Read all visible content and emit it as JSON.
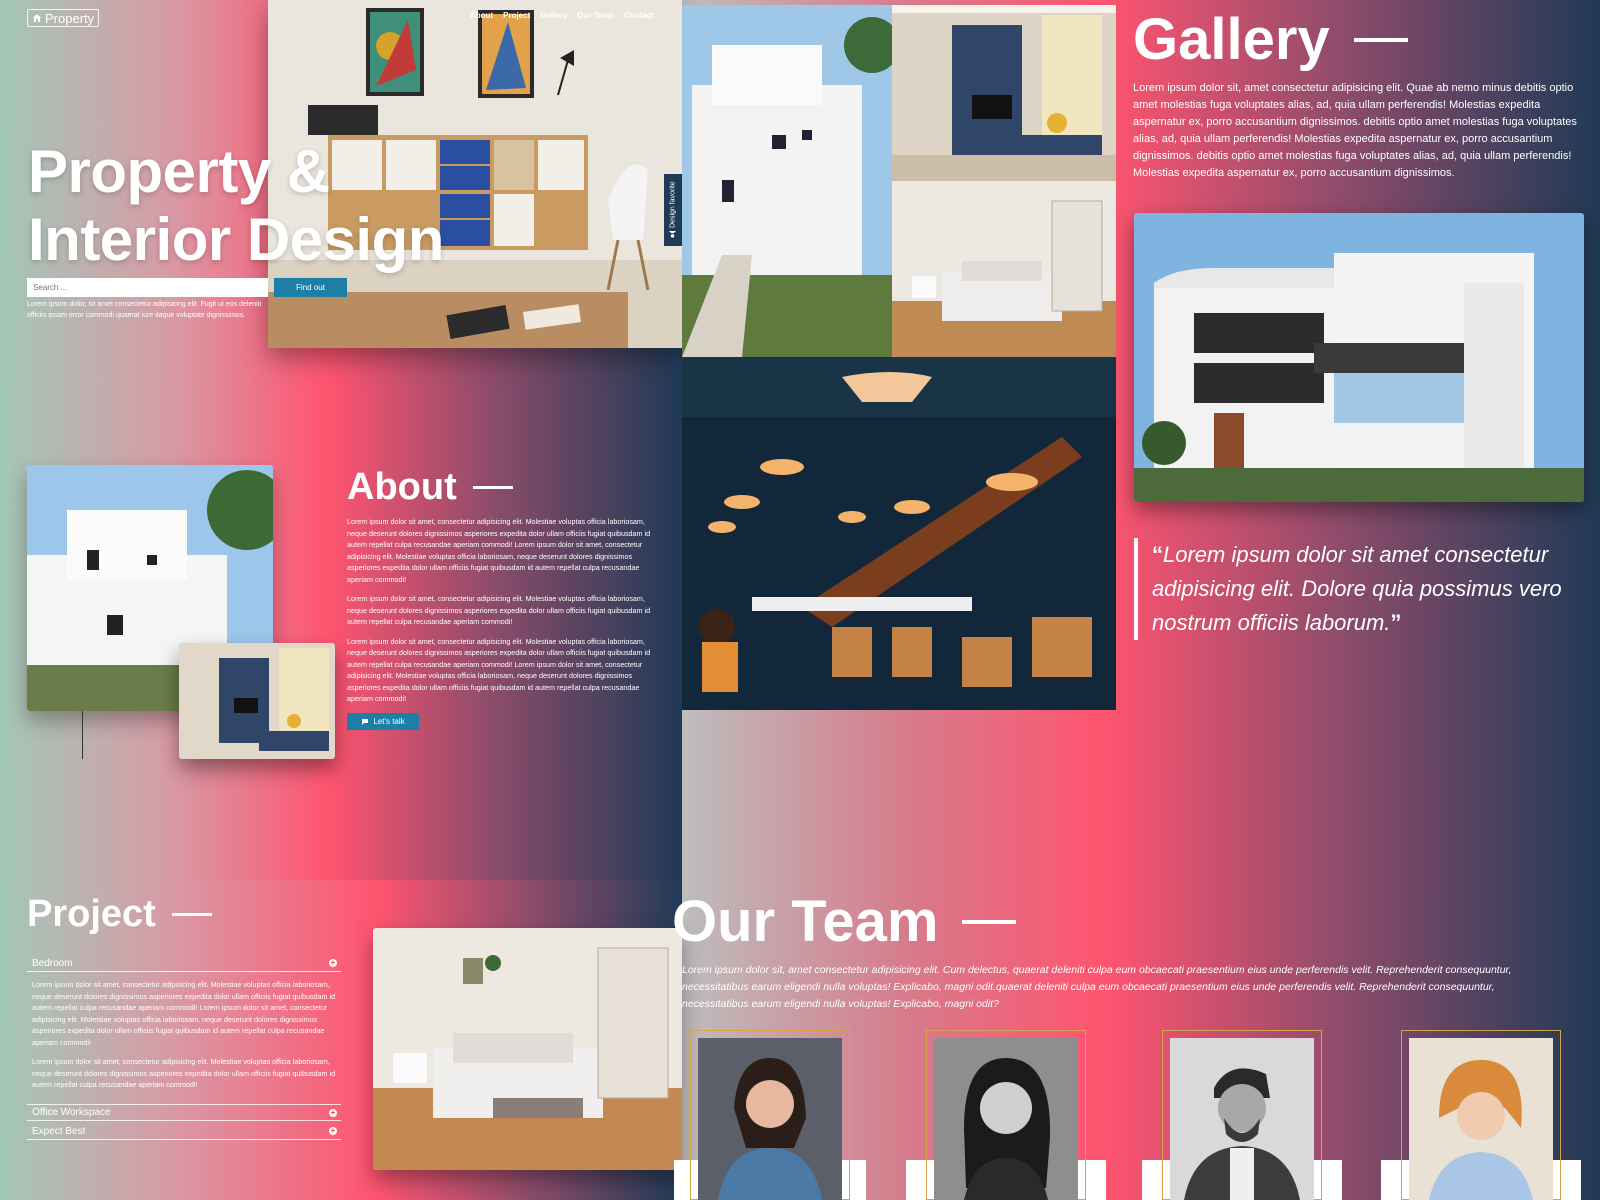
{
  "colors": {
    "accent": "#1d7fa6",
    "pink": "#ff5470",
    "navy": "#1f3a56",
    "frame_gold": "#d7a24a"
  },
  "brand": {
    "name": "Property",
    "icon": "home-icon"
  },
  "nav": [
    "About",
    "Project",
    "Gallery",
    "Our Team",
    "Contact"
  ],
  "hero": {
    "title_line1": "Property &",
    "title_line2": "Interior Design",
    "search_placeholder": "Search ...",
    "find_out": "Find out",
    "subtext": "Lorem ipsum dolor, sit amet consectetur adipisicing elit. Fugit ut eos deleniti officiis ipsam error commodi quaerat iure itaque voluptate dignissimos.",
    "favorite_tab": "Design favorite"
  },
  "about": {
    "title": "About",
    "paragraphs": [
      "Lorem ipsum dolor sit amet, consectetur adipisicing elit. Molestiae voluptas officia laboriosam, neque deserunt dolores dignissimos asperiores expedita dolor ullam officiis fugiat quibusdam id autem repellat culpa recusandae aperiam commodi! Lorem ipsum dolor sit amet, consectetur adipisicing elit. Molestiae voluptas officia laboriosam, neque deserunt dolores dignissimos asperiores expedita dolor ullam officiis fugiat quibusdam id autem repellat culpa recusandae aperiam commodi!",
      "Lorem ipsum dolor sit amet, consectetur adipisicing elit. Molestiae voluptas officia laboriosam, neque deserunt dolores dignissimos asperiores expedita dolor ullam officiis fugiat quibusdam id autem repellat culpa recusandae aperiam commodi!",
      "Lorem ipsum dolor sit amet, consectetur adipisicing elit. Molestiae voluptas officia laboriosam, neque deserunt dolores dignissimos asperiores expedita dolor ullam officiis fugiat quibusdam id autem repellat culpa recusandae aperiam commodi! Lorem ipsum dolor sit amet, consectetur adipisicing elit. Molestiae voluptas officia laboriosam, neque deserunt dolores dignissimos asperiores expedita dolor ullam officiis fugiat quibusdam id autem repellat culpa recusandae aperiam commodi!"
    ],
    "cta": "Let's talk"
  },
  "gallery": {
    "title": "Gallery",
    "text": "Lorem ipsum dolor sit, amet consectetur adipisicing elit. Quae ab nemo minus debitis optio amet molestias fuga voluptates alias, ad, quia ullam perferendis! Molestias expedita aspernatur ex, porro accusantium dignissimos. debitis optio amet molestias fuga voluptates alias, ad, quia ullam perferendis! Molestias expedita aspernatur ex, porro accusantium dignissimos. debitis optio amet molestias fuga voluptates alias, ad, quia ullam perferendis! Molestias expedita aspernatur ex, porro accusantium dignissimos.",
    "quote": "Lorem ipsum dolor sit amet consectetur adipisicing elit. Dolore quia possimus vero nostrum officiis laborum."
  },
  "project": {
    "title": "Project",
    "items": [
      {
        "label": "Bedroom",
        "open": true
      },
      {
        "label": "Office Workspace",
        "open": false
      },
      {
        "label": "Expect Best",
        "open": false
      }
    ],
    "body": [
      "Lorem ipsum dolor sit amet, consectetur adipisicing elit. Molestiae voluptas officia laboriosam, neque deserunt dolores dignissimos asperiores expedita dolor ullam officiis fugiat quibusdam id autem repellat culpa recusandae aperiam commodi! Lorem ipsum dolor sit amet, consectetur adipisicing elit. Molestiae voluptas officia laboriosam, neque deserunt dolores dignissimos asperiores expedita dolor ullam officiis fugiat quibusdam id autem repellat culpa recusandae aperiam commodi!",
      "Lorem ipsum dolor sit amet, consectetur adipisicing elit. Molestiae voluptas officia laboriosam, neque deserunt dolores dignissimos asperiores expedita dolor ullam officiis fugiat quibusdam id autem repellat culpa recusandae aperiam commodi!"
    ]
  },
  "team": {
    "title": "Our Team",
    "text": "Lorem ipsum dolor sit, amet consectetur adipisicing elit. Cum delectus, quaerat deleniti culpa eum obcaecati praesentium eius unde perferendis velit. Reprehenderit consequuntur, necessitatibus earum eligendi nulla voluptas! Explicabo, magni odit.quaerat deleniti culpa eum obcaecati praesentium eius unde perferendis velit. Reprehenderit consequuntur, necessitatibus earum eligendi nulla voluptas! Explicabo, magni odit?"
  }
}
